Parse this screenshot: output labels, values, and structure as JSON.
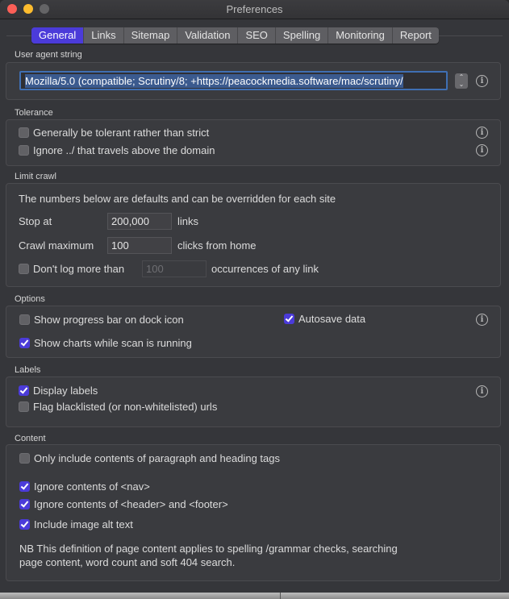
{
  "window": {
    "title": "Preferences"
  },
  "tabs": [
    {
      "label": "General",
      "active": true
    },
    {
      "label": "Links",
      "active": false
    },
    {
      "label": "Sitemap",
      "active": false
    },
    {
      "label": "Validation",
      "active": false
    },
    {
      "label": "SEO",
      "active": false
    },
    {
      "label": "Spelling",
      "active": false
    },
    {
      "label": "Monitoring",
      "active": false
    },
    {
      "label": "Report",
      "active": false
    }
  ],
  "user_agent": {
    "section": "User agent string",
    "value": "Mozilla/5.0 (compatible; Scrutiny/8; +https://peacockmedia.software/mac/scrutiny/"
  },
  "tolerance": {
    "section": "Tolerance",
    "options": [
      {
        "label": "Generally be tolerant rather than strict",
        "checked": false
      },
      {
        "label": "Ignore ../ that travels above the domain",
        "checked": false
      }
    ]
  },
  "limit_crawl": {
    "section": "Limit crawl",
    "note": "The numbers below are defaults and can be overridden for each site",
    "stop_at": {
      "label": "Stop at",
      "value": "200,000",
      "unit": "links"
    },
    "crawl_max": {
      "label": "Crawl maximum",
      "value": "100",
      "unit": "clicks from home"
    },
    "dont_log": {
      "label": "Don't log more than",
      "checked": false,
      "value": "100",
      "unit": "occurrences of any link"
    }
  },
  "options": {
    "section": "Options",
    "progress_bar": {
      "label": "Show progress bar on dock icon",
      "checked": false
    },
    "autosave": {
      "label": "Autosave data",
      "checked": true
    },
    "show_charts": {
      "label": "Show charts while scan is running",
      "checked": true
    }
  },
  "labels": {
    "section": "Labels",
    "display": {
      "label": "Display labels",
      "checked": true
    },
    "flag": {
      "label": "Flag blacklisted (or non-whitelisted) urls",
      "checked": false
    }
  },
  "content": {
    "section": "Content",
    "only_p": {
      "label": "Only include contents of paragraph and heading tags",
      "checked": false
    },
    "ignore_nav": {
      "label": "Ignore contents of <nav>",
      "checked": true
    },
    "ignore_header": {
      "label": "Ignore contents of <header> and <footer>",
      "checked": true
    },
    "alt_text": {
      "label": "Include image alt text",
      "checked": true
    },
    "note_line1": "NB This definition of page content applies to spelling /grammar checks, searching",
    "note_line2": "page content, word count and soft 404 search."
  },
  "colors": {
    "accent": "#4b3bd9",
    "background": "#35363a"
  }
}
